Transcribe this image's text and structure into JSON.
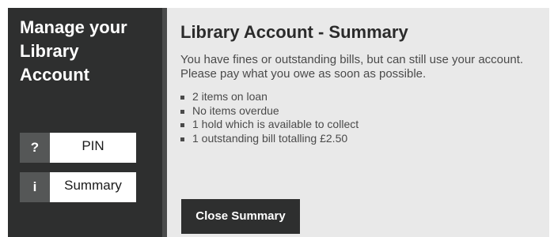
{
  "sidebar": {
    "title": "Manage your Library Account",
    "items": [
      {
        "icon": "?",
        "icon_name": "question-icon",
        "label": "PIN"
      },
      {
        "icon": "i",
        "icon_name": "info-icon",
        "label": "Summary"
      }
    ]
  },
  "main": {
    "title": "Library Account - Summary",
    "notice": "You have fines or outstanding bills, but can still use your account. Please pay what you owe as soon as possible.",
    "items": [
      "2 items on loan",
      "No items overdue",
      "1 hold which is available to collect",
      "1 outstanding bill totalling £2.50"
    ],
    "close_label": "Close Summary"
  },
  "colors": {
    "sidebar_background": "#2e2f2f",
    "sidebar_divider": "#4a4b4b",
    "main_background": "#e9e9e9",
    "icon_background": "#555757",
    "button_background": "#2e2f2f"
  }
}
